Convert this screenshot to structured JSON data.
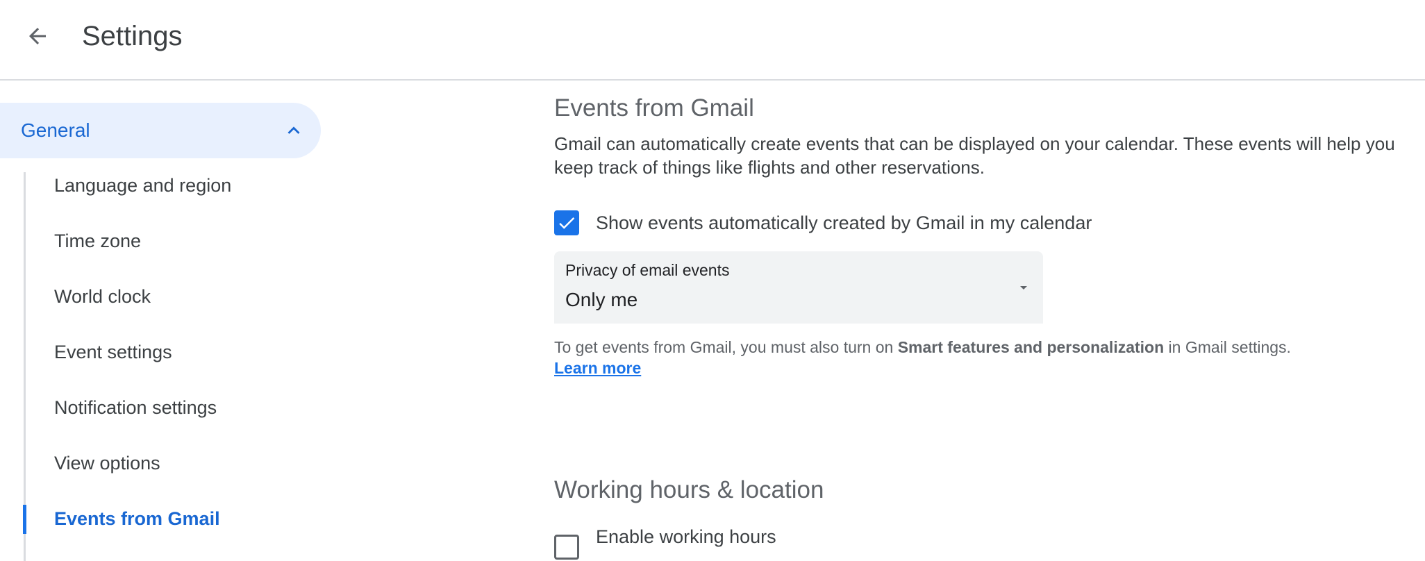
{
  "header": {
    "title": "Settings",
    "back_icon": "arrow-back-icon"
  },
  "sidebar": {
    "group": {
      "label": "General",
      "expanded": true
    },
    "items": [
      {
        "label": "Language and region",
        "active": false
      },
      {
        "label": "Time zone",
        "active": false
      },
      {
        "label": "World clock",
        "active": false
      },
      {
        "label": "Event settings",
        "active": false
      },
      {
        "label": "Notification settings",
        "active": false
      },
      {
        "label": "View options",
        "active": false
      },
      {
        "label": "Events from Gmail",
        "active": true
      }
    ]
  },
  "events_from_gmail": {
    "title": "Events from Gmail",
    "description": "Gmail can automatically create events that can be displayed on your calendar. These events will help you keep track of things like flights and other reservations.",
    "show_events_checkbox": {
      "label": "Show events automatically created by Gmail in my calendar",
      "checked": true
    },
    "privacy_select": {
      "label": "Privacy of email events",
      "value": "Only me"
    },
    "help": {
      "prefix": "To get events from Gmail, you must also turn on ",
      "bold": "Smart features and personalization",
      "suffix": " in Gmail settings.",
      "link": "Learn more"
    }
  },
  "working_hours": {
    "title": "Working hours & location",
    "enable_checkbox": {
      "label": "Enable working hours",
      "checked": false
    }
  },
  "colors": {
    "accent": "#1a73e8",
    "active_text": "#1967d2",
    "active_bg": "#e8f0fe",
    "field_bg": "#f1f3f4"
  }
}
